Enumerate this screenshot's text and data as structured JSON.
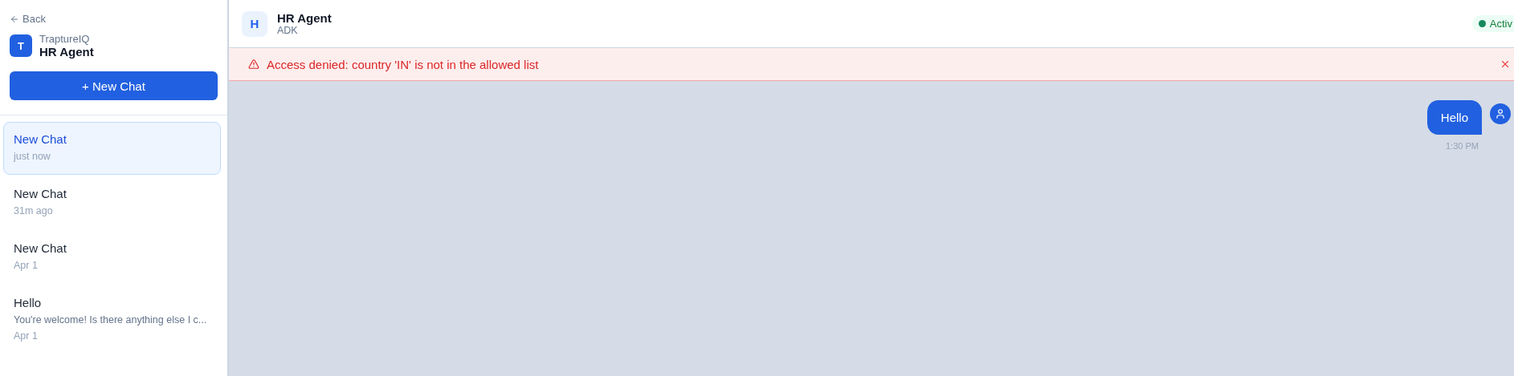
{
  "sidebar": {
    "back": "Back",
    "logo": "T",
    "org": "TraptureIQ",
    "agent": "HR Agent",
    "new_chat": "+ New Chat",
    "chats": [
      {
        "title": "New Chat",
        "time": "just now",
        "selected": true
      },
      {
        "title": "New Chat",
        "time": "31m ago",
        "selected": false
      },
      {
        "title": "New Chat",
        "time": "Apr 1",
        "selected": false
      },
      {
        "title": "Hello",
        "preview": "You're welcome! Is there anything else I c...",
        "time": "Apr 1",
        "selected": false
      }
    ]
  },
  "header": {
    "initial": "H",
    "title": "HR Agent",
    "subtitle": "ADK",
    "status": "Activ"
  },
  "alert": {
    "message": "Access denied: country 'IN' is not in the allowed list"
  },
  "messages": [
    {
      "text": "Hello",
      "time": "1:30 PM"
    }
  ]
}
